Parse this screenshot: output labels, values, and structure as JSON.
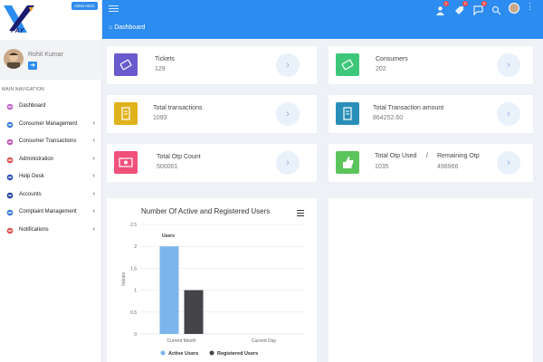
{
  "brand": {
    "admin_badge": "Admin-B2C",
    "logo_text": "PAY"
  },
  "user": {
    "name": "Rohit Kumar"
  },
  "nav": {
    "header": "MAIN NAVIGATION",
    "items": [
      {
        "label": "Dashboard",
        "icon": "dashboard-icon",
        "color": "#c066c8",
        "has_chevron": false
      },
      {
        "label": "Consumer Management",
        "icon": "user-icon",
        "color": "#3b7dd8",
        "has_chevron": true
      },
      {
        "label": "Consumer Transactions",
        "icon": "card-icon",
        "color": "#c05ab0",
        "has_chevron": true
      },
      {
        "label": "Administration",
        "icon": "admin-icon",
        "color": "#e05050",
        "has_chevron": true
      },
      {
        "label": "Help Desk",
        "icon": "helpdesk-icon",
        "color": "#3050c0",
        "has_chevron": true
      },
      {
        "label": "Accounts",
        "icon": "accounts-icon",
        "color": "#2040a0",
        "has_chevron": true
      },
      {
        "label": "Complaint Management",
        "icon": "complaint-icon",
        "color": "#3b7dd8",
        "has_chevron": true
      },
      {
        "label": "Notifications",
        "icon": "bell-icon",
        "color": "#e05050",
        "has_chevron": true
      }
    ]
  },
  "topbar": {
    "badges": [
      "0",
      "0",
      "0"
    ]
  },
  "breadcrumb": {
    "label": "Dashboard"
  },
  "cards": {
    "tickets": {
      "title": "Tickets",
      "value": "129",
      "color": "#6a5acd"
    },
    "consumers": {
      "title": "Consumers",
      "value": "202",
      "color": "#3ec77a"
    },
    "total_transactions": {
      "title": "Total transactions",
      "value": "1093",
      "color": "#e0b21c"
    },
    "total_transaction_amount": {
      "title": "Total Transaction amount",
      "value": "864252.60",
      "color": "#2a8fb8"
    },
    "total_otp_count": {
      "title": "Total Otp Count",
      "value": "500001",
      "color": "#f0507a"
    },
    "otp_used": {
      "title": "Total Otp Used",
      "value": "1035",
      "separator": "/",
      "color": "#5cc45c"
    },
    "remaining_otp": {
      "title": "Remaining Otp",
      "value": "498966"
    }
  },
  "chart_data": {
    "type": "bar",
    "title": "Number Of Active and Registered Users",
    "categories": [
      "Current Month",
      "Current Day"
    ],
    "series": [
      {
        "name": "Active Users",
        "values": [
          2,
          0
        ],
        "color": "#7cb5ec"
      },
      {
        "name": "Registered Users",
        "values": [
          1,
          0
        ],
        "color": "#434348"
      }
    ],
    "ylabel": "Values",
    "annotation": "Users",
    "ylim": [
      0,
      2.5
    ],
    "yticks": [
      "0",
      "0.5",
      "1",
      "1.5",
      "2",
      "2.5"
    ],
    "legend": "bottom",
    "grid": true
  }
}
